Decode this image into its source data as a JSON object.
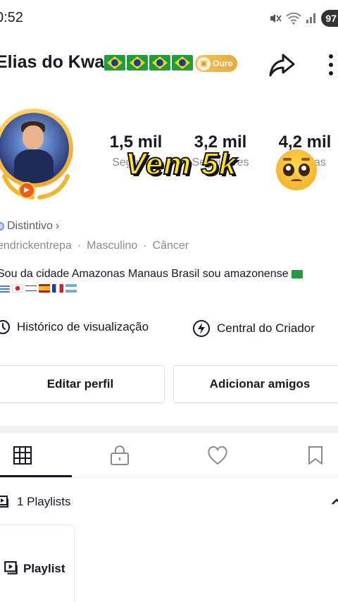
{
  "status_bar": {
    "time": "0:52",
    "battery": "97"
  },
  "profile": {
    "name": "Elias do Kwai",
    "flag_count": 4,
    "badge_label": "Ouro"
  },
  "stats": [
    {
      "value": "1,5 mil",
      "label": "Seguindo"
    },
    {
      "value": "3,2 mil",
      "label": "Seguidores"
    },
    {
      "value": "4,2 mil",
      "label": "Curtidas"
    }
  ],
  "overlay": {
    "text": "Vem 5k"
  },
  "distintivo": {
    "label": "Distintivo",
    "chevron": "›"
  },
  "meta": {
    "username": "endrickentrepa",
    "gender": "Masculino",
    "sign": "Câncer",
    "separator": "·"
  },
  "bio": {
    "text": "Sou da cidade Amazonas Manaus Brasil sou amazonense"
  },
  "quick_links": {
    "history": "Histórico de visualização",
    "creator": "Central do Criador"
  },
  "buttons": {
    "edit": "Editar perfil",
    "add_friends": "Adicionar amigos"
  },
  "tabs": [
    "grid",
    "lock",
    "heart",
    "bookmark"
  ],
  "playlists": {
    "count_label": "1 Playlists",
    "card_label": "Playlist"
  },
  "colors": {
    "gold": "#f0a420",
    "flag_green": "#1f9d3c",
    "overlay_yellow": "#ffe51a"
  }
}
